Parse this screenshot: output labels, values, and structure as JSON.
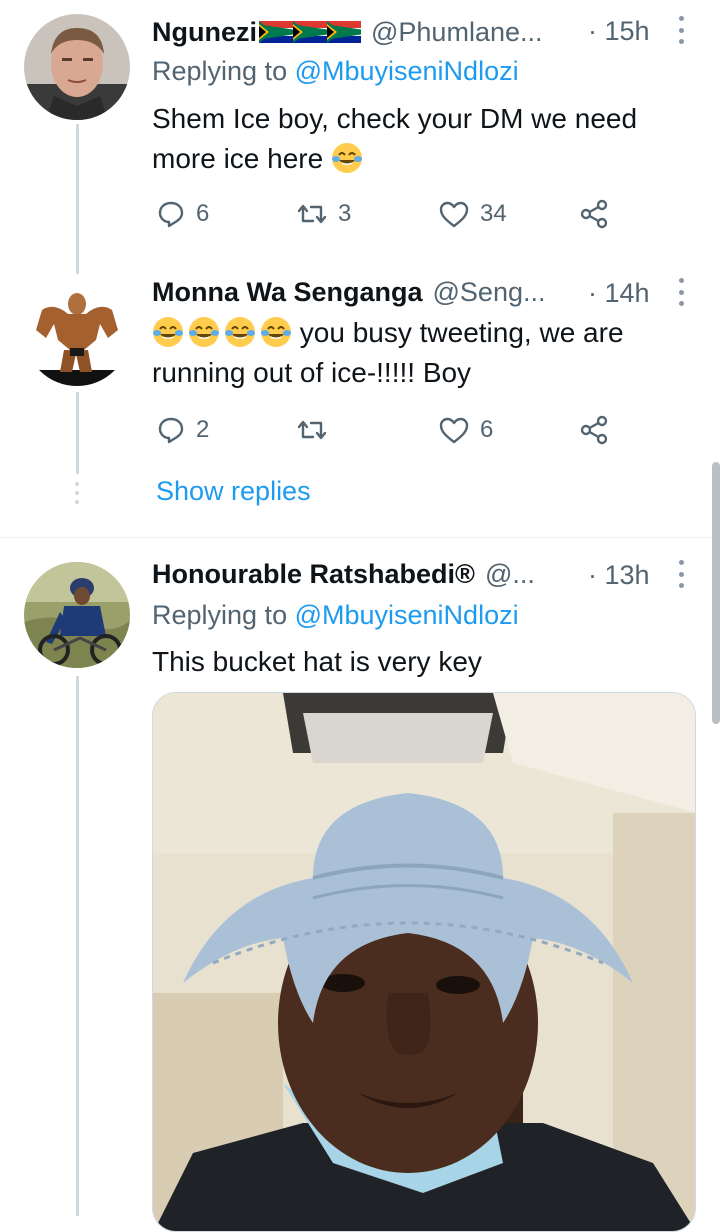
{
  "tweets": [
    {
      "name": "Ngunezi",
      "handle": "@Phumlane...",
      "time": "· 15h",
      "reply_to_prefix": "Replying to ",
      "reply_to_user": "@MbuyiseniNdlozi",
      "text": "Shem Ice boy, check your DM we need more ice here",
      "text_emoji": "face-with-tears-of-joy",
      "replies": "6",
      "retweets": "3",
      "likes": "34"
    },
    {
      "name": "Monna Wa Senganga",
      "handle": "@Seng...",
      "time": "· 14h",
      "text": "you busy tweeting, we are running out of ice-!!!!! Boy",
      "text_emoji": "face-with-tears-of-joy",
      "replies": "2",
      "retweets": "",
      "likes": "6"
    },
    {
      "name": "Honourable Ratshabedi®",
      "handle": "@...",
      "time": "· 13h",
      "reply_to_prefix": "Replying to ",
      "reply_to_user": "@MbuyiseniNdlozi",
      "text": "This bucket hat is very key"
    }
  ],
  "show_replies": "Show replies",
  "colors": {
    "accent": "#1d9bf0",
    "text": "#0f1419",
    "secondary": "#536471",
    "thread_line": "#cfd9de"
  }
}
